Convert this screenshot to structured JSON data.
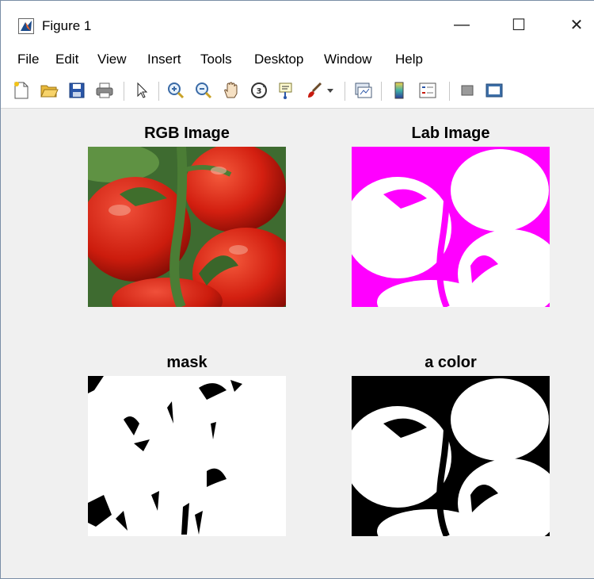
{
  "window": {
    "title": "Figure 1",
    "icon": "matlab-icon",
    "controls": {
      "minimize": "—",
      "maximize": "☐",
      "close": "✕"
    }
  },
  "menu": {
    "items": [
      "File",
      "Edit",
      "View",
      "Insert",
      "Tools",
      "Desktop",
      "Window",
      "Help"
    ]
  },
  "toolbar": {
    "icons": [
      "new-figure-icon",
      "open-file-icon",
      "save-icon",
      "print-icon",
      "pointer-icon",
      "zoom-in-icon",
      "zoom-out-icon",
      "pan-icon",
      "rotate-3d-icon",
      "data-cursor-icon",
      "brush-icon",
      "dropdown-arrow-icon",
      "link-plot-icon",
      "colorbar-icon",
      "legend-icon",
      "hide-plot-tools-icon",
      "show-plot-tools-icon"
    ]
  },
  "axes": [
    {
      "title": "RGB Image"
    },
    {
      "title": "Lab Image"
    },
    {
      "title": "mask"
    },
    {
      "title": "a color"
    }
  ],
  "colors": {
    "tomato_red": "#c81b0f",
    "leaf_green": "#3d6e2b",
    "magenta": "#ff00ff"
  }
}
